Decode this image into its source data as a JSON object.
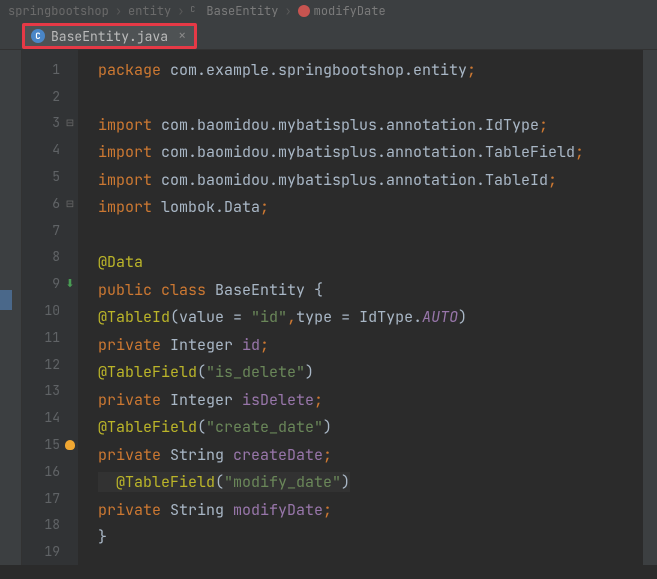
{
  "breadcrumb": {
    "i1": "springbootshop",
    "i2": "entity",
    "i3": "BaseEntity",
    "i4": "modifyDate"
  },
  "tab": {
    "label": "BaseEntity.java",
    "icon_letter": "C"
  },
  "lines": {
    "n1": "1",
    "n2": "2",
    "n3": "3",
    "n4": "4",
    "n5": "5",
    "n6": "6",
    "n7": "7",
    "n8": "8",
    "n9": "9",
    "n10": "10",
    "n11": "11",
    "n12": "12",
    "n13": "13",
    "n14": "14",
    "n15": "15",
    "n16": "16",
    "n17": "17",
    "n18": "18",
    "n19": "19"
  },
  "code": {
    "l1_kw": "package ",
    "l1_pkg": "com.example.springbootshop.entity",
    "semi": ";",
    "l3_kw": "import ",
    "l3_pkg": "com.baomidou.mybatisplus.annotation.IdType",
    "l4_pkg": "com.baomidou.mybatisplus.annotation.TableField",
    "l5_pkg": "com.baomidou.mybatisplus.annotation.TableId",
    "l6_pkg": "lombok.Data",
    "l8_ann": "@Data",
    "l9_pub": "public ",
    "l9_cls": "class ",
    "l9_name": "BaseEntity ",
    "l9_open": "{",
    "l10_ann": "@TableId",
    "l10_paren": "(",
    "l10_value": "value = ",
    "l10_str": "\"id\"",
    "l10_comma": ",",
    "l10_type": "type = IdType.",
    "l10_auto": "AUTO",
    "l10_close": ")",
    "l11_priv": "private ",
    "l11_type": "Integer ",
    "l11_name": "id",
    "l12_ann": "@TableField",
    "l12_str": "\"is_delete\"",
    "l13_type": "Integer ",
    "l13_name": "isDelete",
    "l14_str": "\"create_date\"",
    "l15_type": "String ",
    "l15_name": "createDate",
    "l16_str": "\"modify_date\"",
    "l17_type": "String ",
    "l17_name": "modifyDate",
    "l18_close": "}"
  }
}
